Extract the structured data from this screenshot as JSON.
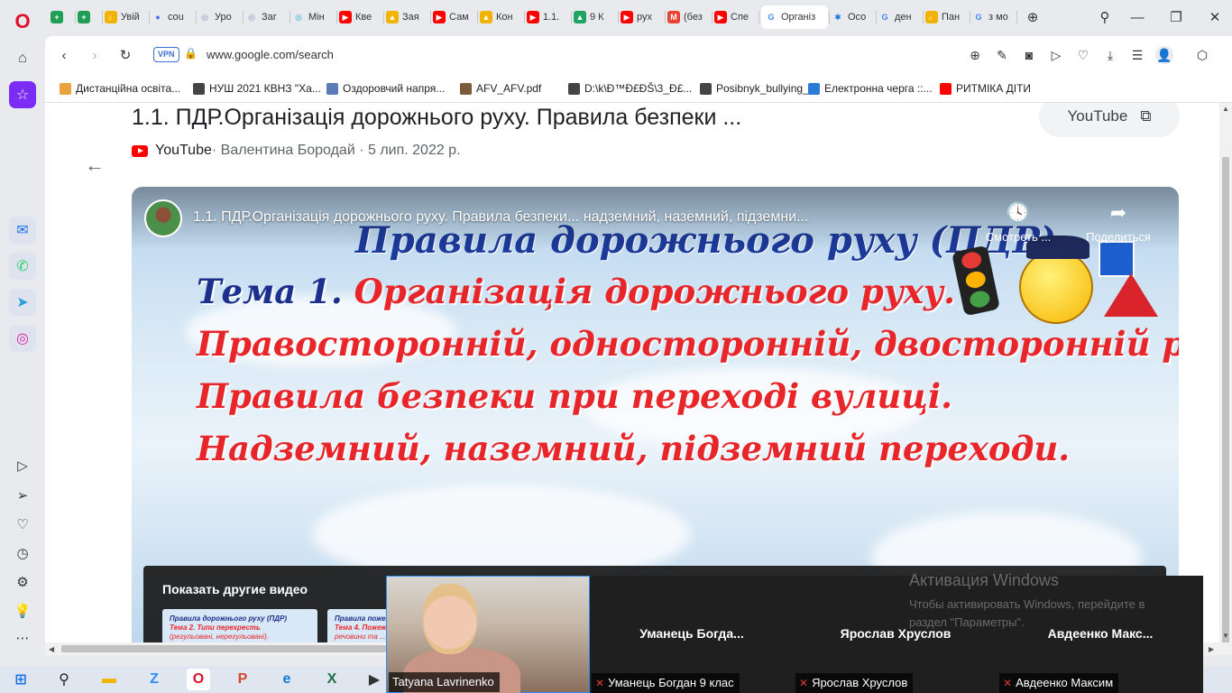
{
  "tabs": [
    {
      "label": "",
      "color": "#1e9f55",
      "glyph": "+"
    },
    {
      "label": "",
      "color": "#1e9f55",
      "glyph": "+"
    },
    {
      "label": "Увій",
      "color": "#f0b400",
      "glyph": "✋"
    },
    {
      "label": "cou",
      "color": "#4a6cf7",
      "glyph": "●"
    },
    {
      "label": "Уро",
      "color": "#7a8fb5",
      "glyph": "◎"
    },
    {
      "label": "Заг",
      "color": "#7a8fb5",
      "glyph": "◎"
    },
    {
      "label": "Мін",
      "color": "#16a7d6",
      "glyph": "◎"
    },
    {
      "label": "Кве",
      "color": "#ff0000",
      "glyph": "▶"
    },
    {
      "label": "Зая",
      "color": "#f0b400",
      "glyph": "▲"
    },
    {
      "label": "Сам",
      "color": "#ff0000",
      "glyph": "▶"
    },
    {
      "label": "Кон",
      "color": "#f0b400",
      "glyph": "▲"
    },
    {
      "label": "1.1.",
      "color": "#ff0000",
      "glyph": "▶"
    },
    {
      "label": "9 К",
      "color": "#1fa463",
      "glyph": "▲"
    },
    {
      "label": "рух",
      "color": "#ff0000",
      "glyph": "▶"
    },
    {
      "label": "(без",
      "color": "#ea4335",
      "glyph": "M"
    },
    {
      "label": "Спе",
      "color": "#ff0000",
      "glyph": "▶"
    },
    {
      "label": "Організ",
      "color": "#4285f4",
      "glyph": "G"
    },
    {
      "label": "Осо",
      "color": "#1a73e8",
      "glyph": "✱"
    },
    {
      "label": "ден",
      "color": "#4285f4",
      "glyph": "G"
    },
    {
      "label": "Пан",
      "color": "#f0b400",
      "glyph": "✋"
    },
    {
      "label": "з мо",
      "color": "#4285f4",
      "glyph": "G"
    }
  ],
  "address": {
    "vpn": "VPN",
    "url": "www.google.com/search"
  },
  "bookmarks": [
    {
      "label": "Дистанційна освіта...",
      "color": "#e8a33d"
    },
    {
      "label": "НУШ 2021 КВНЗ \"Ха...",
      "color": "#444444"
    },
    {
      "label": "Оздоровчий напря...",
      "color": "#5a7bb5"
    },
    {
      "label": "AFV_AFV.pdf",
      "color": "#7a5b3a"
    },
    {
      "label": "D:\\k\\Ð™Ð£ÐŠ\\3_Ð£...",
      "color": "#444444"
    },
    {
      "label": "Posibnyk_bullying_...",
      "color": "#444444"
    },
    {
      "label": "Електронна черга ::...",
      "color": "#2a7bd6"
    },
    {
      "label": "РИТМІКА ДІТИ",
      "color": "#ff0000"
    }
  ],
  "result": {
    "title": "1.1. ПДР.Організація дорожнього руху. Правила безпеки ...",
    "source": "YouTube",
    "author": " · Валентина Бородай · 5 лип. 2022 р.",
    "chip_label": "YouTube"
  },
  "video": {
    "title": "1.1. ПДР.Організація дорожнього руху. Правила безпеки... надземний, наземний, підземни...",
    "watch_later": "Смотреть ...",
    "share": "Поделиться",
    "slide_heading": "Правила дорожнього руху (ПДР)",
    "slide_topic_prefix": "Тема 1. ",
    "slide_topic": "Організація дорожнього руху.",
    "slide_line2": "Правосторонній, односторонній, двосторонній рух.",
    "slide_line3": "Правила безпеки при переході вулиці.",
    "slide_line4": "Надземний, наземний, підземний переходи.",
    "more_videos": "Показать другие видео",
    "thumb1": {
      "l1": "Правила дорожнього руху (ПДР)",
      "l2": "Тема 2. Типи перехресть",
      "l3": "(регульовані, нерегульовані)."
    },
    "thumb2": {
      "l1": "Правила пожеж...",
      "l2": "Тема 4. Пожеж...",
      "l3": "речовини та ..."
    }
  },
  "activation": {
    "heading": "Активация Windows",
    "line1": "Чтобы активировать Windows, перейдите в",
    "line2": "раздел \"Параметры\"."
  },
  "meeting": {
    "participants": [
      {
        "center": "",
        "label": "Tatyana Lavrinenko",
        "muted": false
      },
      {
        "center": "Уманець  Богда...",
        "label": "Уманець Богдан 9 клас",
        "muted": true
      },
      {
        "center": "Ярослав Хруслов",
        "label": "Ярослав Хруслов",
        "muted": true
      },
      {
        "center": "Авдеенко  Макс...",
        "label": "Авдеенко Максим",
        "muted": true
      }
    ]
  }
}
